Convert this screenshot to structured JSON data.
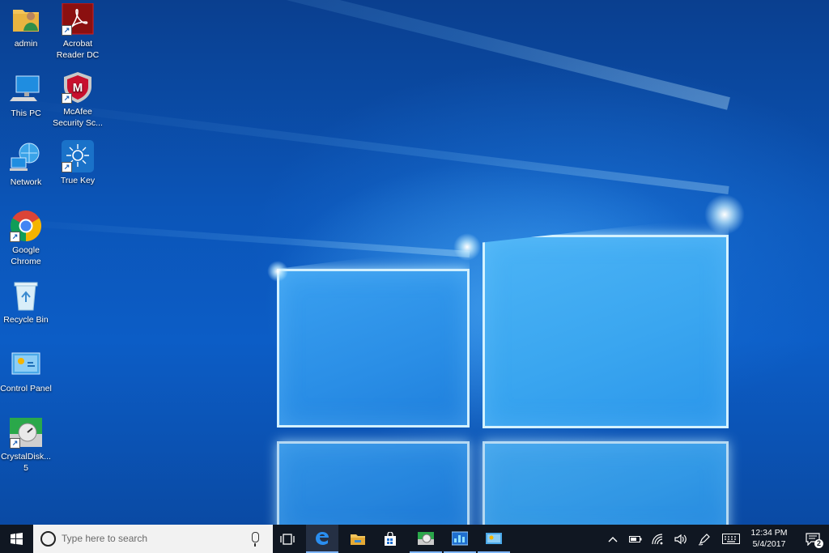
{
  "desktop": {
    "icons": [
      {
        "label": "admin",
        "icon": "user-folder-icon"
      },
      {
        "label": "Acrobat Reader DC",
        "icon": "acrobat-icon"
      },
      {
        "label": "This PC",
        "icon": "computer-icon"
      },
      {
        "label": "McAfee Security Sc...",
        "icon": "mcafee-icon"
      },
      {
        "label": "Network",
        "icon": "network-icon"
      },
      {
        "label": "True Key",
        "icon": "truekey-icon"
      },
      {
        "label": "Google Chrome",
        "icon": "chrome-icon"
      },
      {
        "label": "Recycle Bin",
        "icon": "recycle-bin-icon"
      },
      {
        "label": "Control Panel",
        "icon": "control-panel-icon"
      },
      {
        "label": "CrystalDisk... 5",
        "icon": "crystaldisk-icon"
      }
    ]
  },
  "taskbar": {
    "search_placeholder": "Type here to search",
    "apps": [
      "edge-icon",
      "file-explorer-icon",
      "store-icon",
      "crystaldisk-icon",
      "task-manager-icon",
      "control-panel-icon"
    ],
    "clock": {
      "time": "12:34 PM",
      "date": "5/4/2017"
    },
    "notification_count": "2"
  },
  "colors": {
    "taskbar": "#101722",
    "accent": "#7fb6ff",
    "wallpaper": "#0c5dc6"
  }
}
